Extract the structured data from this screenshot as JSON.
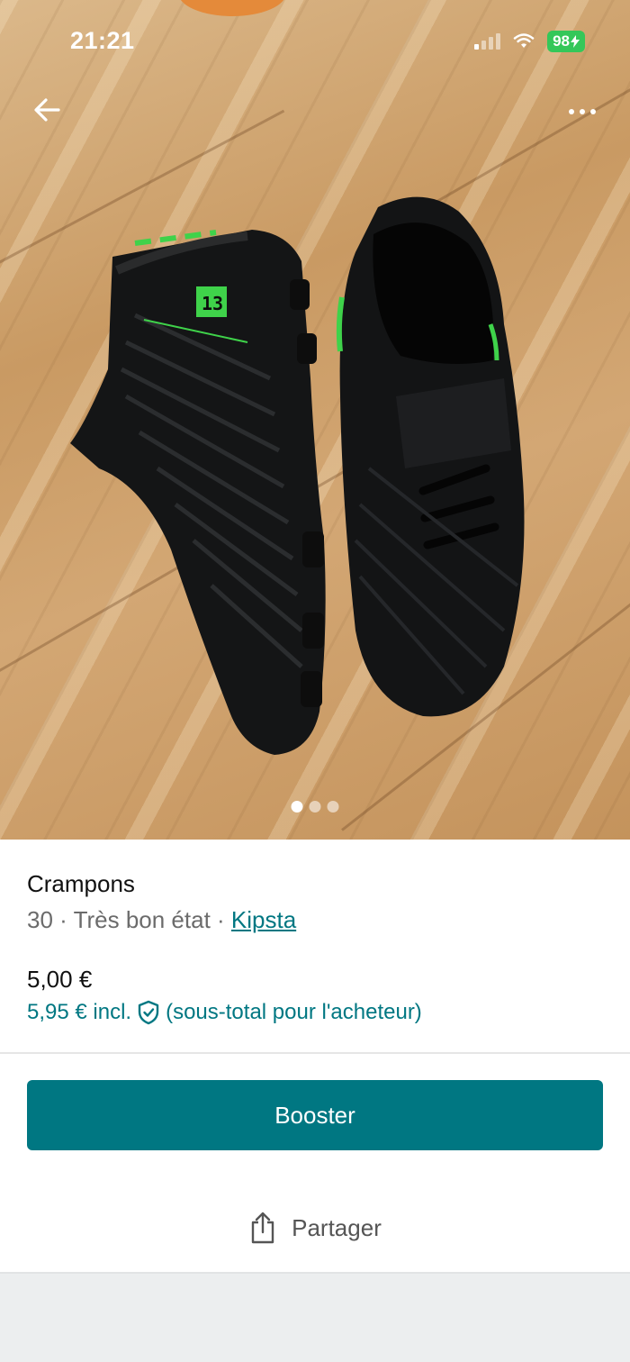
{
  "status_bar": {
    "time": "21:21",
    "battery": "98",
    "battery_color": "#34c759"
  },
  "photo": {
    "description_icon": "product-photo",
    "page_count": 3,
    "current_page": 1
  },
  "nav": {
    "back_icon": "arrow-left-icon",
    "more_icon": "more-dots-icon"
  },
  "item": {
    "title": "Crampons",
    "size": "30",
    "condition": "Très bon état",
    "separator": " · ",
    "brand": "Kipsta",
    "price": "5,00 €",
    "price_incl": "5,95 € incl.",
    "price_incl_note": "(sous-total pour l'acheteur)"
  },
  "actions": {
    "boost_label": "Booster",
    "share_label": "Partager"
  },
  "colors": {
    "accent": "#007782",
    "text_secondary": "#6b6b6b"
  }
}
